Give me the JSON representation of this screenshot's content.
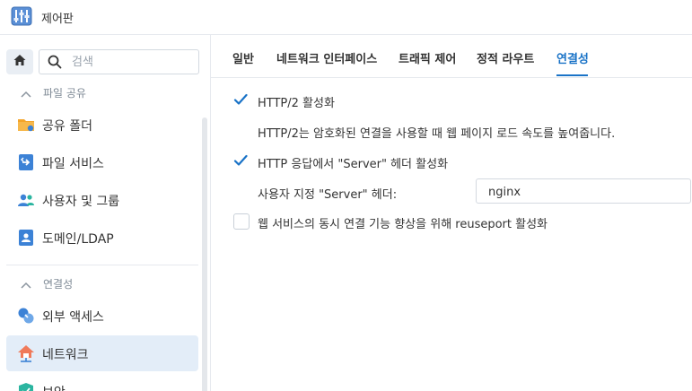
{
  "app": {
    "title": "제어판"
  },
  "sidebar": {
    "search_placeholder": "검색",
    "sections": [
      {
        "label": "파일 공유",
        "items": [
          {
            "label": "공유 폴더",
            "icon": "shared-folder-icon"
          },
          {
            "label": "파일 서비스",
            "icon": "file-services-icon"
          },
          {
            "label": "사용자 및 그룹",
            "icon": "user-group-icon"
          },
          {
            "label": "도메인/LDAP",
            "icon": "domain-ldap-icon"
          }
        ]
      },
      {
        "label": "연결성",
        "items": [
          {
            "label": "외부 액세스",
            "icon": "external-access-icon"
          },
          {
            "label": "네트워크",
            "icon": "network-icon",
            "active": true
          },
          {
            "label": "보안",
            "icon": "security-icon"
          }
        ]
      }
    ]
  },
  "tabs": [
    {
      "label": "일반"
    },
    {
      "label": "네트워크 인터페이스"
    },
    {
      "label": "트래픽 제어"
    },
    {
      "label": "정적 라우트"
    },
    {
      "label": "연결성",
      "active": true
    }
  ],
  "settings": {
    "http2": {
      "label": "HTTP/2 활성화",
      "checked": true,
      "description": "HTTP/2는 암호화된 연결을 사용할 때 웹 페이지 로드 속도를 높여줍니다."
    },
    "server_header": {
      "label": "HTTP 응답에서 \"Server\" 헤더 활성화",
      "checked": true,
      "field_label": "사용자 지정 \"Server\" 헤더:",
      "field_value": "nginx"
    },
    "reuseport": {
      "label": "웹 서비스의 동시 연결 기능 향상을 위해 reuseport 활성화",
      "checked": false
    }
  },
  "colors": {
    "accent": "#1a73c7",
    "active_item_bg": "#e3edf8"
  }
}
